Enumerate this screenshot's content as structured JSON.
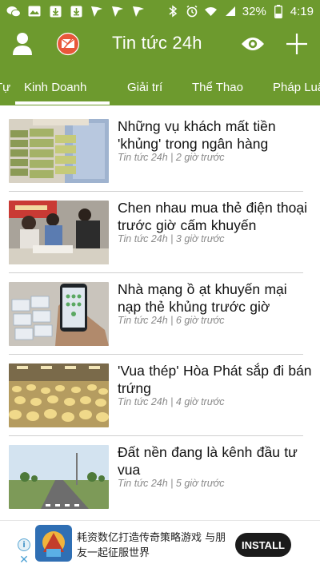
{
  "status_bar": {
    "battery": "32%",
    "time": "4:19",
    "left_icons": [
      "wechat-icon",
      "gallery-icon",
      "download-icon",
      "download-icon",
      "vidmate-icon",
      "vidmate-icon",
      "vidmate-icon"
    ],
    "right_icons": [
      "bluetooth-icon",
      "alarm-icon",
      "wifi-icon",
      "signal-icon",
      "battery-icon"
    ]
  },
  "toolbar": {
    "title": "Tin tức 24h",
    "accent_color": "#6d9a2e"
  },
  "tabs": [
    {
      "label": "Tự"
    },
    {
      "label": "Kinh Doanh",
      "selected": true
    },
    {
      "label": "Giải trí"
    },
    {
      "label": "Thể Thao"
    },
    {
      "label": "Pháp Luật"
    }
  ],
  "articles": [
    {
      "title": "Những vụ khách mất tiền 'khủng' trong ngân hàng",
      "meta": "Tin tức 24h | 2 giờ trước"
    },
    {
      "title": "Chen nhau mua thẻ điện thoại trước giờ cấm khuyến",
      "meta": "Tin tức 24h | 3 giờ trước"
    },
    {
      "title": "Nhà mạng ồ ạt khuyến mại nạp thẻ khủng trước giờ",
      "meta": "Tin tức 24h | 6 giờ trước"
    },
    {
      "title": "'Vua thép' Hòa Phát sắp đi bán trứng",
      "meta": "Tin tức 24h | 4 giờ trước"
    },
    {
      "title": "Đất nền đang là kênh đầu tư vua",
      "meta": "Tin tức 24h | 5 giờ trước"
    }
  ],
  "ad": {
    "text": "耗资数亿打造传奇策略游戏 与朋友一起征服世界",
    "install_label": "INSTALL"
  }
}
